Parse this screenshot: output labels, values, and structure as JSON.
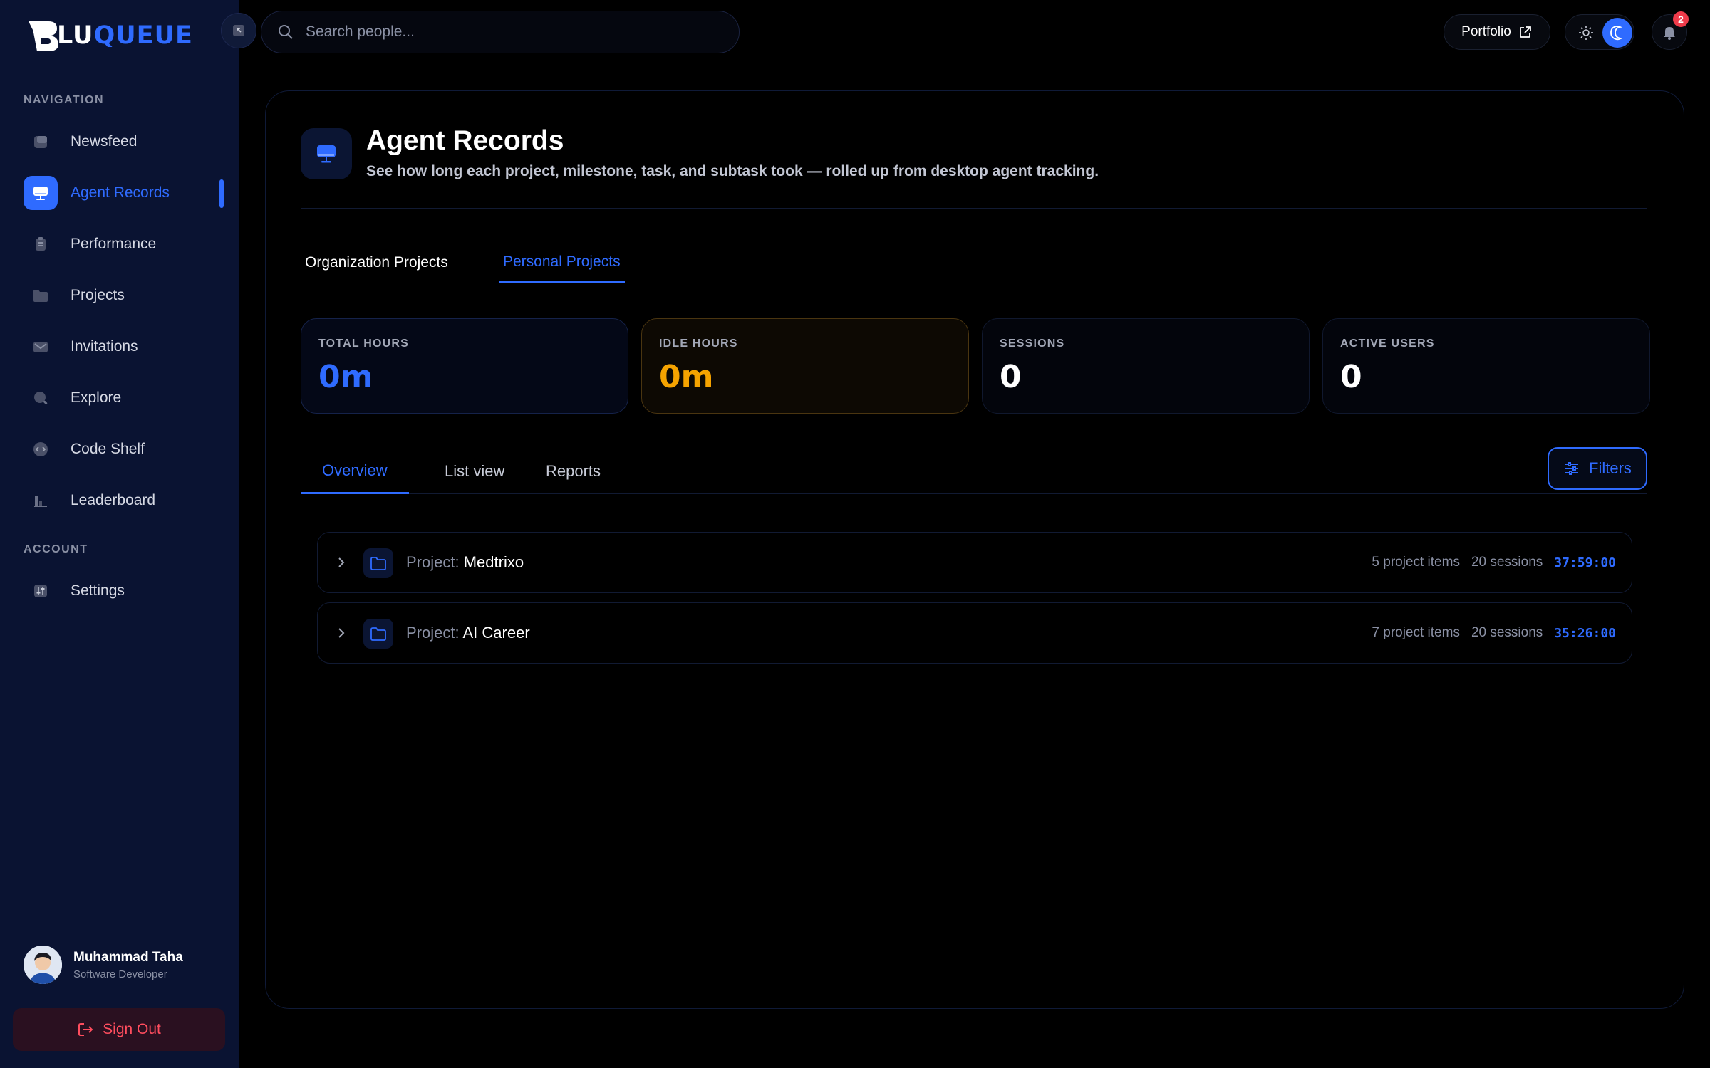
{
  "app": {
    "brand_lu": "LU",
    "brand_queue": "QUEUE"
  },
  "colors": {
    "accent": "#2f6bff",
    "idle": "#f5a300",
    "danger": "#ff4d5e",
    "sidebar_bg": "#0a1332"
  },
  "sidebar": {
    "nav_heading": "NAVIGATION",
    "account_heading": "ACCOUNT",
    "items": [
      {
        "label": "Newsfeed",
        "icon": "newsfeed-icon",
        "active": false
      },
      {
        "label": "Agent Records",
        "icon": "monitor-icon",
        "active": true
      },
      {
        "label": "Performance",
        "icon": "clipboard-icon",
        "active": false
      },
      {
        "label": "Projects",
        "icon": "folder-icon",
        "active": false
      },
      {
        "label": "Invitations",
        "icon": "mail-icon",
        "active": false
      },
      {
        "label": "Explore",
        "icon": "search-icon",
        "active": false
      },
      {
        "label": "Code Shelf",
        "icon": "code-icon",
        "active": false
      },
      {
        "label": "Leaderboard",
        "icon": "chart-icon",
        "active": false
      }
    ],
    "account_items": [
      {
        "label": "Settings",
        "icon": "settings-icon"
      }
    ],
    "user": {
      "name": "Muhammad Taha",
      "role": "Software Developer"
    },
    "sign_out": "Sign Out"
  },
  "header": {
    "search_placeholder": "Search people...",
    "portfolio_label": "Portfolio",
    "notification_count": "2"
  },
  "page": {
    "title": "Agent Records",
    "subtitle": "See how long each project, milestone, task, and subtask took — rolled up from desktop agent tracking.",
    "top_tabs": [
      {
        "label": "Organization Projects",
        "active": false
      },
      {
        "label": "Personal Projects",
        "active": true
      }
    ],
    "stats": [
      {
        "label": "TOTAL HOURS",
        "value": "0m"
      },
      {
        "label": "IDLE HOURS",
        "value": "0m"
      },
      {
        "label": "SESSIONS",
        "value": "0"
      },
      {
        "label": "ACTIVE USERS",
        "value": "0"
      }
    ],
    "sub_tabs": [
      {
        "label": "Overview",
        "active": true
      },
      {
        "label": "List view",
        "active": false
      },
      {
        "label": "Reports",
        "active": false
      }
    ],
    "filters_label": "Filters",
    "projects": [
      {
        "prefix": "Project:",
        "name": "Medtrixo",
        "items": "5 project items",
        "sessions": "20 sessions",
        "duration": "37:59:00"
      },
      {
        "prefix": "Project:",
        "name": "AI Career",
        "items": "7 project items",
        "sessions": "20 sessions",
        "duration": "35:26:00"
      }
    ]
  }
}
